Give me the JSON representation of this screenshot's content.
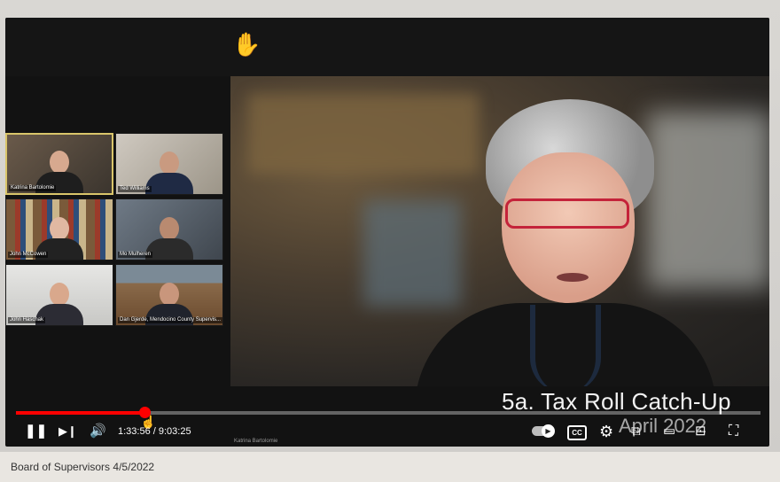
{
  "gallery": {
    "tiles": [
      {
        "name": "Katrina Bartolomie"
      },
      {
        "name": "Ted Williams"
      },
      {
        "name": "John McCowen"
      },
      {
        "name": "Mo Mulheren"
      },
      {
        "name": "John Haschak"
      },
      {
        "name": "Dan Gjerde, Mendocino County Supervis..."
      }
    ]
  },
  "video": {
    "caption": "5a. Tax Roll Catch-Up",
    "date_overlay": "April 2022",
    "speaker_label": "Katrina Bartolomie"
  },
  "player": {
    "progress_fraction": 0.1724,
    "current_time": "1:33:56",
    "duration": "9:03:25",
    "time_separator": " / ",
    "accent_color": "#ff0000"
  },
  "page": {
    "video_title": "Board of Supervisors 4/5/2022"
  },
  "icons": {
    "hand": "raised-hand-icon",
    "pause": "pause-icon",
    "next": "next-icon",
    "volume": "volume-icon",
    "autoplay": "autoplay-toggle",
    "cc": "CC",
    "settings": "gear-icon",
    "miniplayer": "miniplayer-icon",
    "theater": "theater-icon",
    "cast": "cast-icon",
    "fullscreen": "fullscreen-icon"
  }
}
